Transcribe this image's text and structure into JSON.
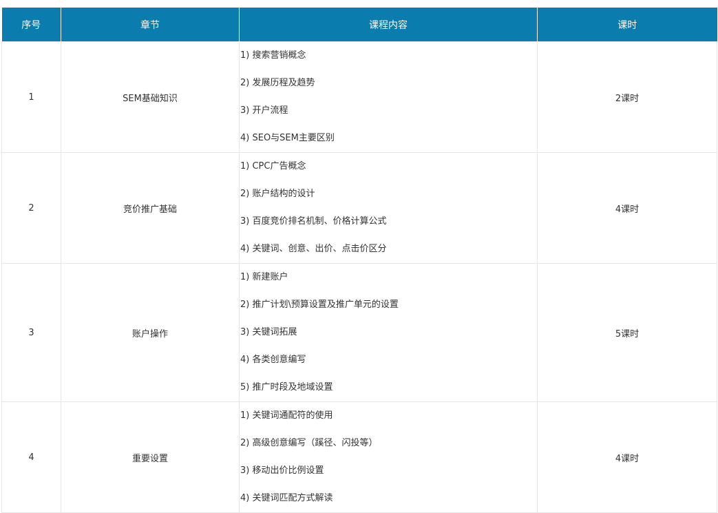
{
  "table": {
    "headers": [
      "序号",
      "章节",
      "课程内容",
      "课时"
    ],
    "rows": [
      {
        "no": "1",
        "chapter": "SEM基础知识",
        "items": [
          "1) 搜索营销概念",
          "2) 发展历程及趋势",
          "3) 开户流程",
          "4) SEO与SEM主要区别"
        ],
        "hours": "2课时"
      },
      {
        "no": "2",
        "chapter": "竞价推广基础",
        "items": [
          "1) CPC广告概念",
          "2) 账户结构的设计",
          "3) 百度竞价排名机制、价格计算公式",
          "4) 关键词、创意、出价、点击价区分"
        ],
        "hours": "4课时"
      },
      {
        "no": "3",
        "chapter": "账户操作",
        "items": [
          "1) 新建账户",
          "2) 推广计划\\预算设置及推广单元的设置",
          "3) 关键词拓展",
          "4) 各类创意编写",
          "5) 推广时段及地域设置"
        ],
        "hours": "5课时"
      },
      {
        "no": "4",
        "chapter": "重要设置",
        "items": [
          "1) 关键词通配符的使用",
          "2) 高级创意编写（蹊径、闪投等）",
          "3) 移动出价比例设置",
          "4) 关键词匹配方式解读"
        ],
        "hours": "4课时"
      }
    ]
  },
  "colors": {
    "header_bg": "#0a7cad",
    "header_text": "#ffffff",
    "border": "#e6e6e6",
    "text": "#333333"
  }
}
